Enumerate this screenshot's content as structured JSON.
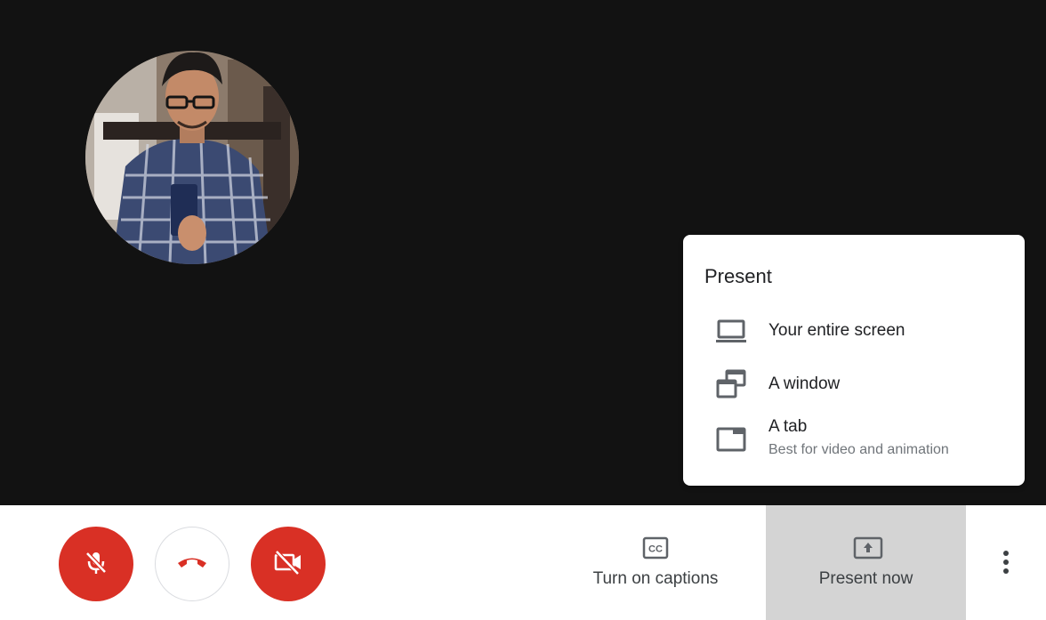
{
  "participant": {
    "avatar_icon": "participant-photo"
  },
  "present_menu": {
    "title": "Present",
    "items": [
      {
        "icon": "laptop-icon",
        "label": "Your entire screen"
      },
      {
        "icon": "window-icon",
        "label": "A window"
      },
      {
        "icon": "tab-icon",
        "label": "A tab",
        "sublabel": "Best for video and animation"
      }
    ]
  },
  "toolbar": {
    "mic": {
      "icon": "mic-off-icon",
      "state": "muted"
    },
    "hangup": {
      "icon": "hangup-icon"
    },
    "camera": {
      "icon": "camera-off-icon",
      "state": "off"
    },
    "captions_label": "Turn on captions",
    "present_label": "Present now",
    "more": {
      "icon": "more-vert-icon"
    }
  },
  "colors": {
    "stage_bg": "#121212",
    "danger": "#d93025",
    "active_tab_bg": "#d4d4d4",
    "text_primary": "#202124",
    "text_secondary": "#70757a"
  }
}
